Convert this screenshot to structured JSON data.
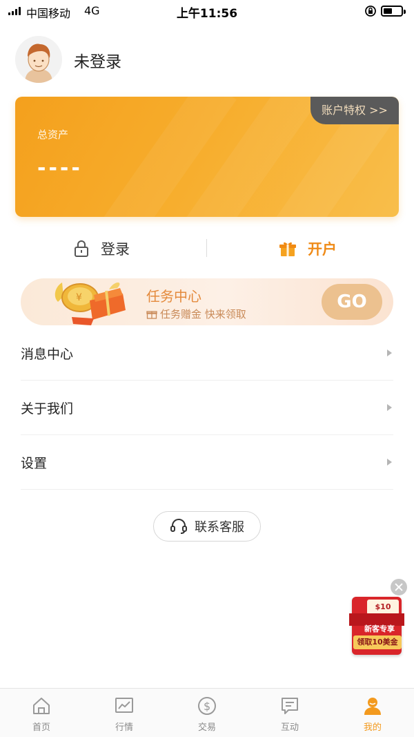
{
  "status_bar": {
    "carrier": "中国移动",
    "network": "4G",
    "time": "上午11:56"
  },
  "profile": {
    "login_state": "未登录"
  },
  "asset_card": {
    "privilege_link": "账户特权 >>",
    "label": "总资产",
    "value": "----"
  },
  "auth": {
    "login_label": "登录",
    "open_account_label": "开户"
  },
  "task_banner": {
    "title": "任务中心",
    "subtitle": "任务赠金 快来领取",
    "button": "GO"
  },
  "menu": {
    "items": [
      {
        "label": "消息中心"
      },
      {
        "label": "关于我们"
      },
      {
        "label": "设置"
      }
    ]
  },
  "support": {
    "label": "联系客服"
  },
  "promo": {
    "cash": "$10",
    "line1": "新客专享",
    "line2": "领取10美金"
  },
  "tabbar": {
    "tabs": [
      {
        "label": "首页",
        "icon": "home-icon"
      },
      {
        "label": "行情",
        "icon": "chart-icon"
      },
      {
        "label": "交易",
        "icon": "dollar-icon"
      },
      {
        "label": "互动",
        "icon": "chat-icon"
      },
      {
        "label": "我的",
        "icon": "user-icon"
      }
    ],
    "active_index": 4
  },
  "colors": {
    "accent": "#f39a1e",
    "card_gradient_start": "#f4a01d",
    "card_gradient_end": "#f8be4b",
    "privilege_tab": "#5a5a5a"
  }
}
